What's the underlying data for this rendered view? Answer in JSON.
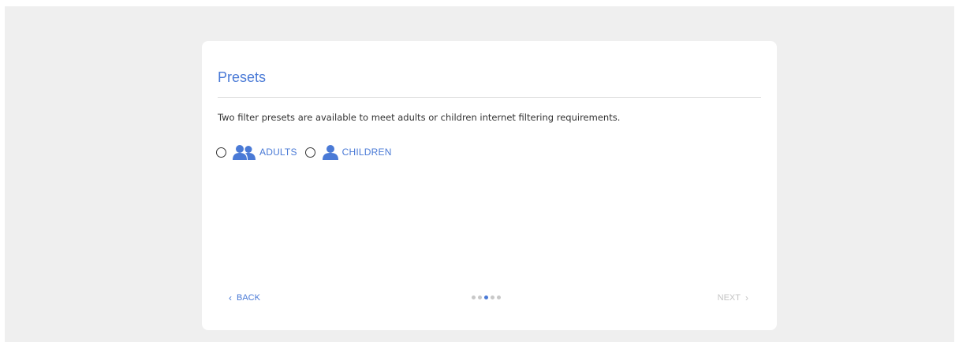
{
  "card": {
    "title": "Presets",
    "description": "Two filter presets are available to meet adults or children internet filtering requirements."
  },
  "presets": [
    {
      "label": "ADULTS",
      "icon": "adults-icon",
      "selected": false
    },
    {
      "label": "CHILDREN",
      "icon": "child-icon",
      "selected": false
    }
  ],
  "navigation": {
    "back_label": "BACK",
    "next_label": "NEXT",
    "total_steps": 5,
    "current_step": 3
  },
  "colors": {
    "accent": "#4a7ad6",
    "disabled": "#c4c4c4",
    "background": "#efefef"
  }
}
